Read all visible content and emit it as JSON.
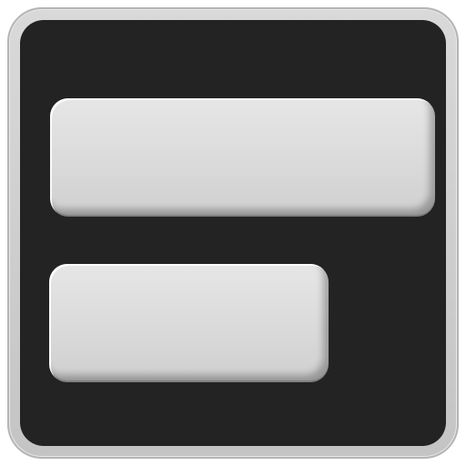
{
  "icon": {
    "name": "layout-bars-icon",
    "colors": {
      "frame": "#d1d1d1",
      "face": "#232323",
      "bar": "#dcdcdc"
    },
    "bars": [
      {
        "name": "top-bar"
      },
      {
        "name": "bottom-bar"
      }
    ]
  }
}
